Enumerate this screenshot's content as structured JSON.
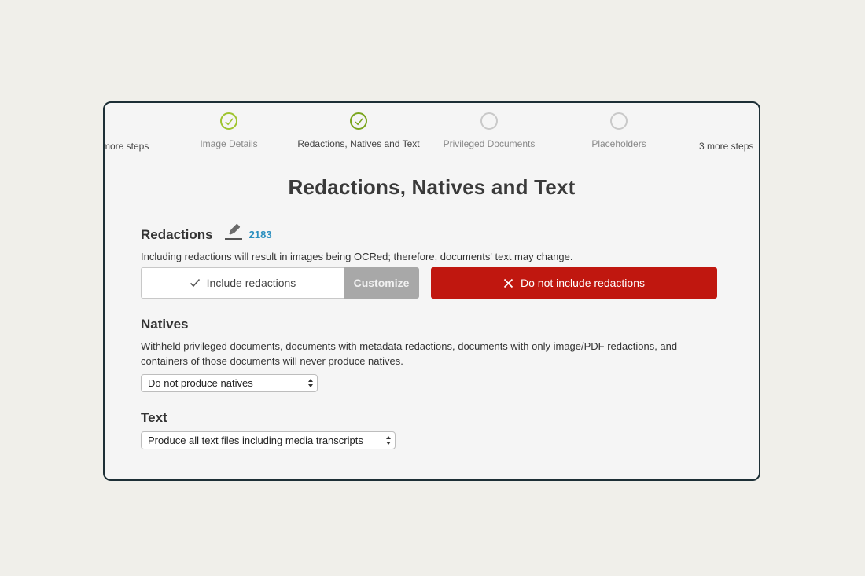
{
  "stepper": {
    "more_left": "more steps",
    "more_right": "3 more steps",
    "steps": [
      {
        "label": "Image Details",
        "state": "done"
      },
      {
        "label": "Redactions, Natives and Text",
        "state": "current"
      },
      {
        "label": "Privileged Documents",
        "state": "pending"
      },
      {
        "label": "Placeholders",
        "state": "pending"
      }
    ]
  },
  "page": {
    "title": "Redactions, Natives and Text"
  },
  "redactions": {
    "heading": "Redactions",
    "icon": "redaction-marker-icon",
    "count": "2183",
    "description": "Including redactions will result in images being OCRed; therefore, documents' text may change.",
    "include_label": "Include redactions",
    "customize_label": "Customize",
    "exclude_label": "Do not include redactions",
    "selected": "Do not include redactions"
  },
  "natives": {
    "heading": "Natives",
    "description": "Withheld privileged documents, documents with metadata redactions, documents with only image/PDF redactions, and containers of those documents will never produce natives.",
    "selected": "Do not produce natives"
  },
  "text": {
    "heading": "Text",
    "selected": "Produce all text files including media transcripts"
  },
  "colors": {
    "accent_green": "#9fc42f",
    "danger_red": "#c0170f",
    "count_blue": "#2b8fbf"
  }
}
